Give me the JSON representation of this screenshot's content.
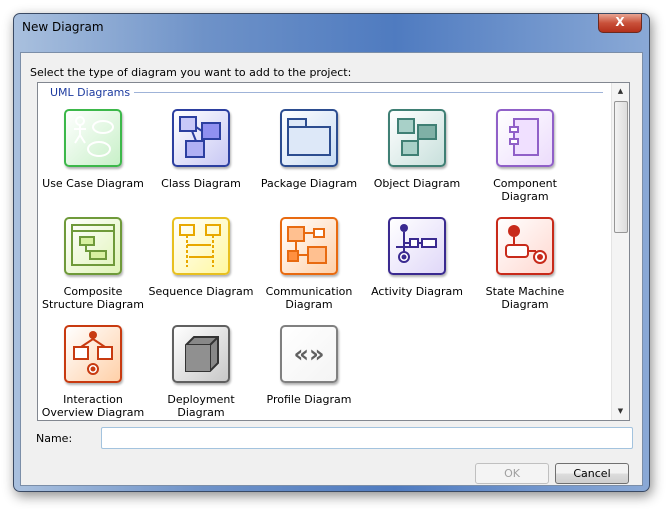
{
  "window": {
    "title": "New Diagram",
    "close_label": "X"
  },
  "prompt": "Select the type of diagram you want to add to the project:",
  "group": {
    "label": "UML Diagrams",
    "items": [
      {
        "label": "Use Case Diagram",
        "icon": "use-case-icon",
        "color": "#3cb84a"
      },
      {
        "label": "Class Diagram",
        "icon": "class-icon",
        "color": "#2c3fa0"
      },
      {
        "label": "Package Diagram",
        "icon": "package-icon",
        "color": "#2c4d90"
      },
      {
        "label": "Object Diagram",
        "icon": "object-icon",
        "color": "#3f7f74"
      },
      {
        "label": "Component Diagram",
        "icon": "component-icon",
        "color": "#9060c8"
      },
      {
        "label": "Composite Structure Diagram",
        "icon": "composite-structure-icon",
        "color": "#6f9a3a"
      },
      {
        "label": "Sequence Diagram",
        "icon": "sequence-icon",
        "color": "#e8c020"
      },
      {
        "label": "Communication Diagram",
        "icon": "communication-icon",
        "color": "#e86a10"
      },
      {
        "label": "Activity Diagram",
        "icon": "activity-icon",
        "color": "#3a2a90"
      },
      {
        "label": "State Machine Diagram",
        "icon": "state-machine-icon",
        "color": "#c82a1a"
      },
      {
        "label": "Interaction Overview Diagram",
        "icon": "interaction-overview-icon",
        "color": "#c83a10"
      },
      {
        "label": "Deployment Diagram",
        "icon": "deployment-icon",
        "color": "#606060"
      },
      {
        "label": "Profile Diagram",
        "icon": "profile-icon",
        "color": "#808080"
      }
    ]
  },
  "name": {
    "label": "Name:",
    "value": ""
  },
  "buttons": {
    "ok": "OK",
    "cancel": "Cancel"
  }
}
